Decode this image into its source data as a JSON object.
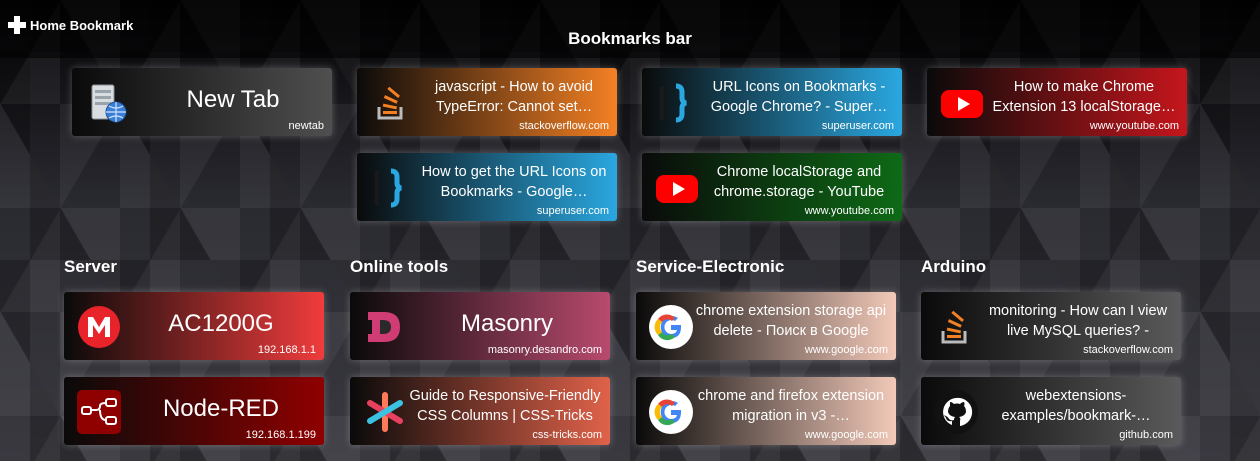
{
  "header": {
    "home_bookmark": "Home Bookmark",
    "bar_title": "Bookmarks bar"
  },
  "bookmarks_bar": [
    {
      "title": "New Tab",
      "domain": "newtab"
    },
    {
      "title": "javascript - How to avoid TypeError: Cannot set…",
      "domain": "stackoverflow.com"
    },
    {
      "title": "URL Icons on Bookmarks - Google Chrome? - Super…",
      "domain": "superuser.com"
    },
    {
      "title": "How to make Chrome Extension 13 localStorage…",
      "domain": "www.youtube.com"
    },
    {
      "title": "How to get the URL Icons on Bookmarks - Google…",
      "domain": "superuser.com"
    },
    {
      "title": "Chrome localStorage and chrome.storage - YouTube",
      "domain": "www.youtube.com"
    }
  ],
  "sections": [
    {
      "title": "Server",
      "items": [
        {
          "title": "AC1200G",
          "domain": "192.168.1.1"
        },
        {
          "title": "Node-RED",
          "domain": "192.168.1.199"
        }
      ]
    },
    {
      "title": "Online tools",
      "items": [
        {
          "title": "Masonry",
          "domain": "masonry.desandro.com"
        },
        {
          "title": "Guide to Responsive-Friendly CSS Columns | CSS-Tricks -…",
          "domain": "css-tricks.com"
        }
      ]
    },
    {
      "title": "Service-Electronic",
      "items": [
        {
          "title": "chrome extension storage api delete - Поиск в Google",
          "domain": "www.google.com"
        },
        {
          "title": "chrome and firefox extension migration in v3 -…",
          "domain": "www.google.com"
        }
      ]
    },
    {
      "title": "Arduino",
      "items": [
        {
          "title": "monitoring - How can I view live MySQL queries? - Stack…",
          "domain": "stackoverflow.com"
        },
        {
          "title": "webextensions-examples/bookmark-…",
          "domain": "github.com"
        }
      ]
    }
  ],
  "colors": {
    "stackoverflow": "#f48024",
    "superuser": "#2aa7e0",
    "youtube_red": "#c4161c",
    "youtube_green": "#0e6a16",
    "server_red": "#f03c3c",
    "nodered": "#8f0000",
    "masonry": "#b84a6e",
    "csstricks": "#e0624a",
    "google": "#f2c9b9",
    "github": "#5a5a5a"
  }
}
